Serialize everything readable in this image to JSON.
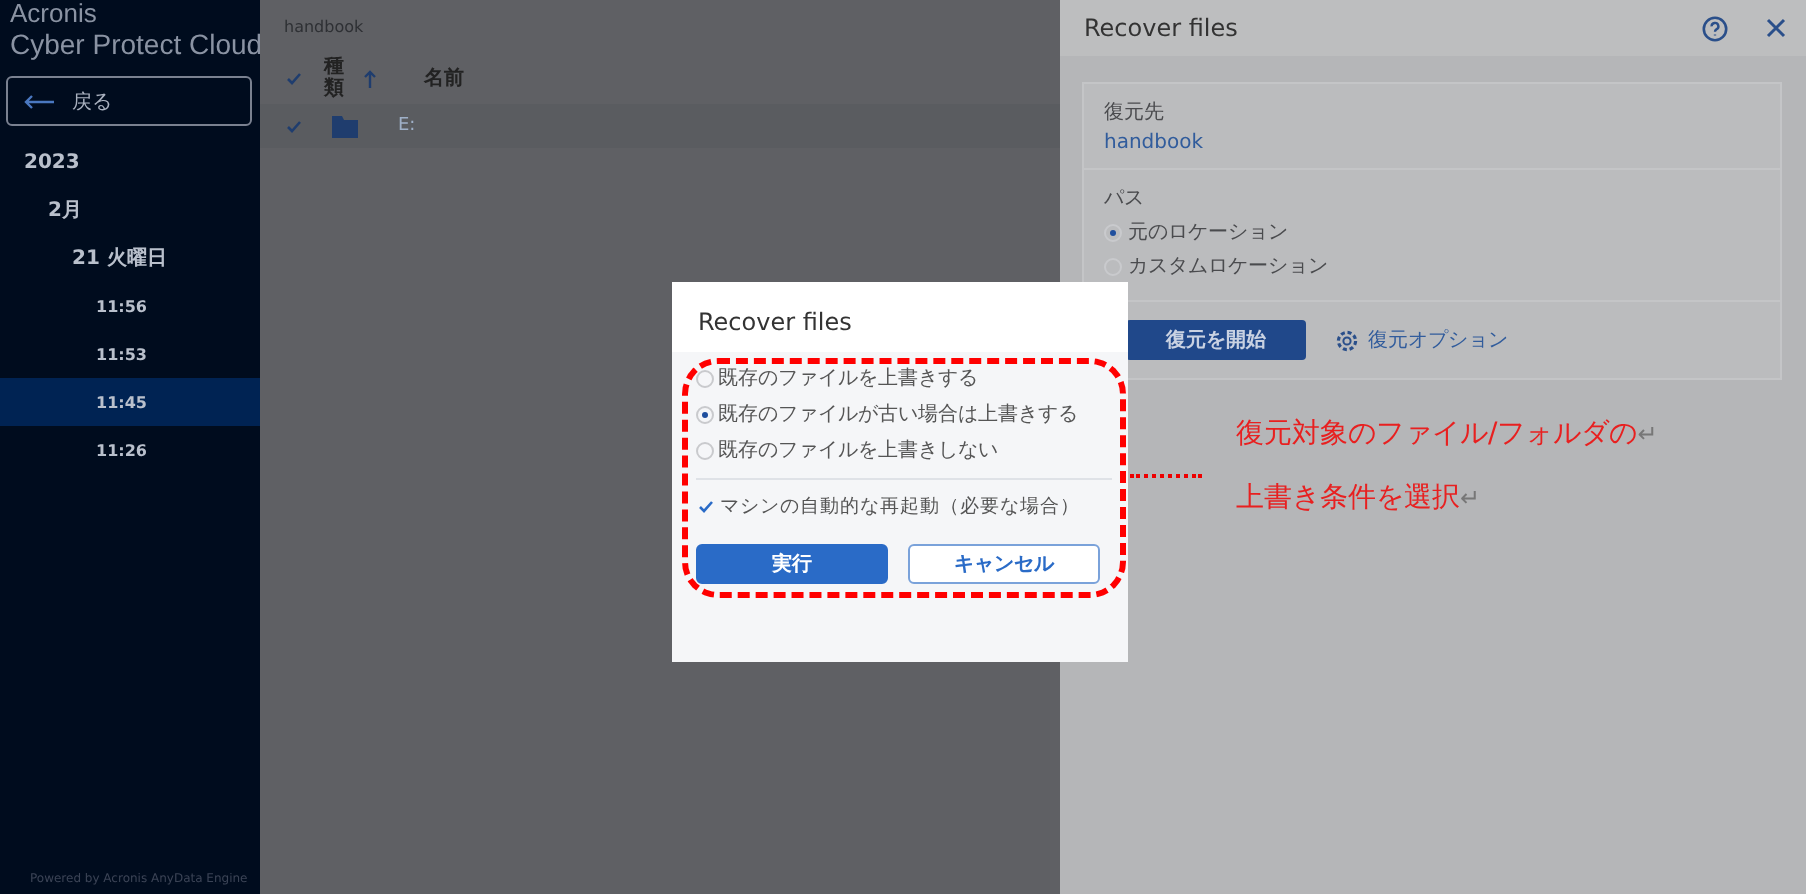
{
  "sidebar": {
    "logo_line_1": "Acronis",
    "logo_line_2": "Cyber Protect Cloud",
    "back_button": "戻る",
    "tree": [
      {
        "label": "2023",
        "selected": false,
        "children": [
          {
            "label": "2月",
            "selected": false,
            "children": [
              {
                "label": "21 火曜日",
                "selected": false,
                "children": [
                  {
                    "label": "11:56",
                    "selected": false
                  },
                  {
                    "label": "11:53",
                    "selected": false
                  },
                  {
                    "label": "11:45",
                    "selected": true
                  },
                  {
                    "label": "11:26",
                    "selected": false
                  }
                ]
              }
            ]
          }
        ]
      }
    ],
    "footer": "Powered by Acronis AnyData Engine"
  },
  "main": {
    "breadcrumb": "handbook",
    "header_checked": true,
    "columns": [
      "種類",
      "名前"
    ],
    "rows": [
      {
        "checked": true,
        "name": "E:"
      }
    ]
  },
  "panel": {
    "title": "Recover files",
    "destination_label": "復元先",
    "destination": "handbook",
    "path_label": "パス",
    "path_options": [
      {
        "label": "元のロケーション",
        "selected": true
      },
      {
        "label": "カスタムロケーション",
        "selected": false
      }
    ],
    "start_button": "復元を開始",
    "options_link": "復元オプション"
  },
  "dialog": {
    "title": "Recover files",
    "overwrite_options": [
      {
        "label": "既存のファイルを上書きする",
        "selected": false
      },
      {
        "label": "既存のファイルが古い場合は上書きする",
        "selected": true
      },
      {
        "label": "既存のファイルを上書きしない",
        "selected": false
      }
    ],
    "reboot": {
      "label": "マシンの自動的な再起動（必要な場合）",
      "checked": true
    },
    "buttons": [
      {
        "label": "実行",
        "kind": "primary"
      },
      {
        "label": "キャンセル",
        "kind": "secondary"
      }
    ]
  },
  "annotation": {
    "lines": [
      {
        "text": "復元対象のファイル/フォルダの",
        "mark": "↵"
      },
      {
        "text": "上書き条件を選択",
        "mark": "↵"
      }
    ]
  }
}
